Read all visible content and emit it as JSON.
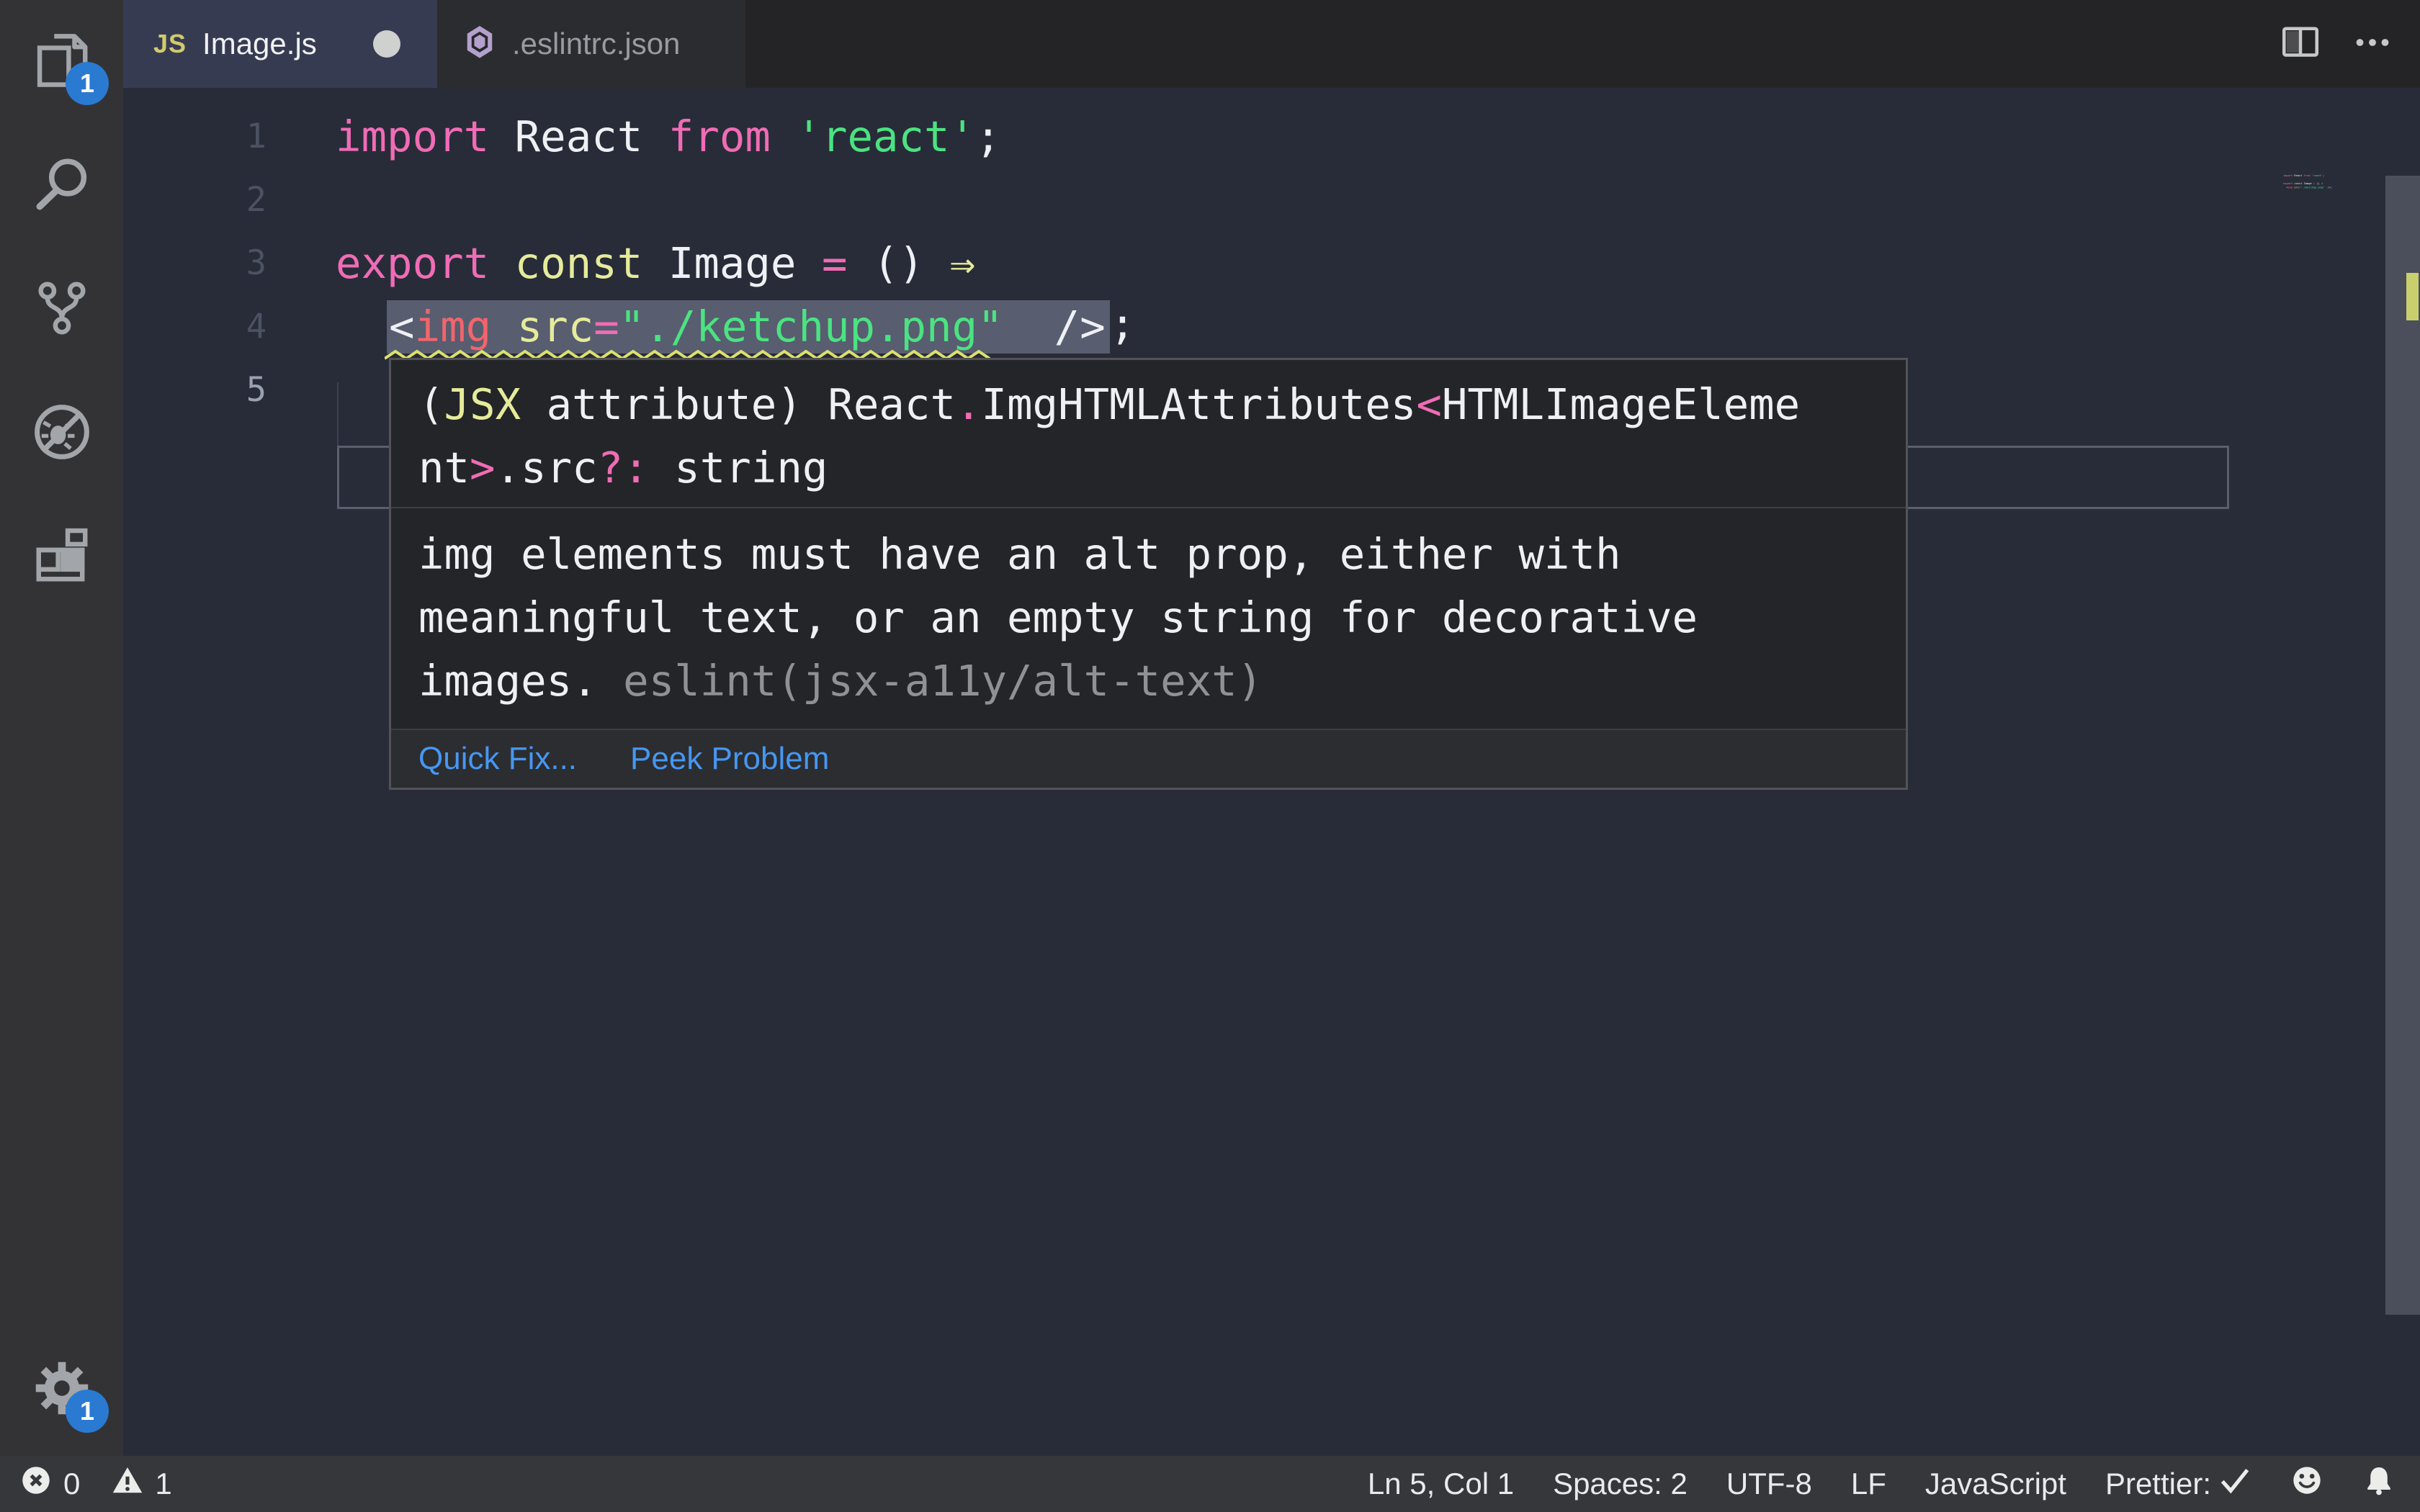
{
  "colors": {
    "editor_bg": "#282c39",
    "activity_bg": "#333336",
    "tabbar_bg": "#242427",
    "tab_active_bg": "#373b52",
    "tab_inactive_bg": "#2b2c2f",
    "tab_inactive_fg": "#9a9ba0",
    "status_bg": "#36373b",
    "popup_bg": "#242528",
    "popup_footer_bg": "#2c2d30",
    "popup_border": "#535357",
    "divider": "#3e3f42",
    "accent_blue": "#4697f2",
    "badge_blue": "#2a7ad1",
    "pink": "#f06cb5",
    "yellow": "#e6eb9b",
    "green": "#4be381",
    "red": "#f2656c",
    "fg": "#eef0f4",
    "line_num": "#4b5263",
    "line_num_active": "#9aa1b2",
    "gray_link": "#909194",
    "squiggle": "#dce26b",
    "hl_box": "#585d70",
    "cur_line_border": "#5a5f6d",
    "scrollbar": "#4a4f5b",
    "warn_marker": "#c9cf6d",
    "icon_gray": "#a2a5a9"
  },
  "activity_bar": {
    "items": [
      {
        "icon": "explorer-icon",
        "badge": "1"
      },
      {
        "icon": "search-icon"
      },
      {
        "icon": "source-control-icon"
      },
      {
        "icon": "debug-disabled-icon"
      },
      {
        "icon": "extensions-icon"
      }
    ],
    "manage": {
      "icon": "gear-icon",
      "badge": "1"
    }
  },
  "tabs": [
    {
      "label": "Image.js",
      "icon": "js-icon",
      "js_badge": "JS",
      "modified": true,
      "active": true
    },
    {
      "label": ".eslintrc.json",
      "icon": "eslint-icon",
      "modified": false,
      "active": false
    }
  ],
  "editor": {
    "active_line": "5",
    "lines": [
      {
        "num": "1",
        "tokens": [
          [
            "import",
            "pink"
          ],
          [
            " React ",
            "fg"
          ],
          [
            "from",
            "pink"
          ],
          [
            " ",
            "fg"
          ],
          [
            "'react'",
            "green"
          ],
          [
            ";",
            "fg"
          ]
        ]
      },
      {
        "num": "2",
        "tokens": []
      },
      {
        "num": "3",
        "tokens": [
          [
            "export",
            "pink"
          ],
          [
            " ",
            "fg"
          ],
          [
            "const",
            "yellow"
          ],
          [
            " ",
            "fg"
          ],
          [
            "Image",
            "fg"
          ],
          [
            " ",
            "fg"
          ],
          [
            "=",
            "pink"
          ],
          [
            " () ",
            "fg"
          ],
          [
            "⇒",
            "yellow"
          ]
        ]
      },
      {
        "num": "4",
        "indent": "  ",
        "box_tokens": [
          [
            "<",
            "fg"
          ],
          [
            "img",
            "red"
          ],
          [
            " ",
            "fg"
          ],
          [
            "src",
            "yellow"
          ],
          [
            "=",
            "pink"
          ],
          [
            "\"./ketchup.png\"",
            "green"
          ],
          [
            "  ",
            "fg"
          ],
          [
            "/>",
            "fg"
          ]
        ],
        "tail_tokens": [
          [
            ";",
            "fg"
          ]
        ],
        "squiggle_chars": 24
      },
      {
        "num": "5",
        "tokens": []
      }
    ]
  },
  "hover_popup": {
    "signature_lines": [
      [
        [
          "(",
          "fg"
        ],
        [
          "JSX",
          "yellow"
        ],
        [
          " attribute) React",
          "fg"
        ],
        [
          ".",
          "pink"
        ],
        [
          "ImgHTMLAttributes",
          "fg"
        ],
        [
          "<",
          "pink"
        ],
        [
          "HTMLImageEleme",
          "fg"
        ]
      ],
      [
        [
          "nt",
          "fg"
        ],
        [
          ">",
          "pink"
        ],
        [
          ".src",
          "fg"
        ],
        [
          "?:",
          "pink"
        ],
        [
          " string",
          "fg"
        ]
      ]
    ],
    "body_lines": [
      "img elements must have an alt prop, either with",
      "meaningful text, or an empty string for decorative"
    ],
    "body_last_line": {
      "text": "images. ",
      "code": "eslint(jsx-a11y/alt-text)"
    },
    "actions": [
      {
        "label": "Quick Fix..."
      },
      {
        "label": "Peek Problem"
      }
    ]
  },
  "status_bar": {
    "errors": "0",
    "warnings": "1",
    "items": [
      {
        "label": "Ln 5, Col 1"
      },
      {
        "label": "Spaces: 2"
      },
      {
        "label": "UTF-8"
      },
      {
        "label": "LF"
      },
      {
        "label": "JavaScript"
      },
      {
        "label": "Prettier:",
        "icon": "check-icon"
      },
      {
        "icon": "smiley-icon"
      },
      {
        "icon": "bell-icon"
      }
    ]
  }
}
